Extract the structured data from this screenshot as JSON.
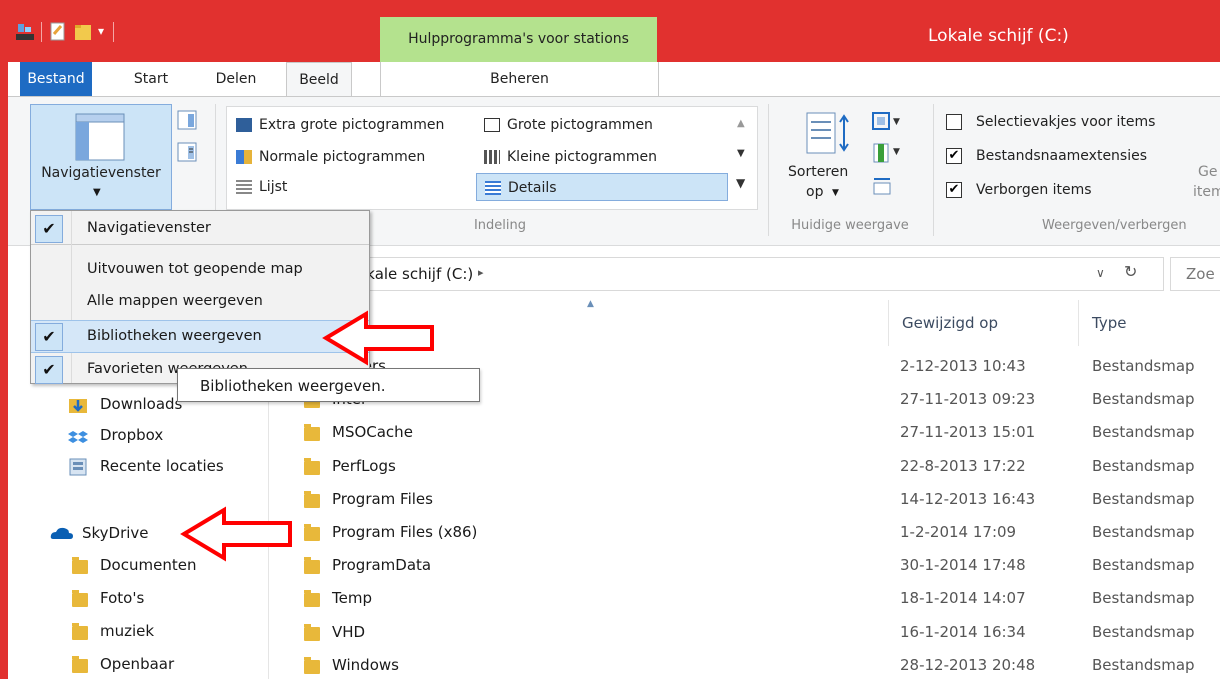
{
  "window": {
    "title": "Lokale schijf (C:)",
    "context_tab": "Hulpprogramma's voor stations",
    "context_subtab": "Beheren",
    "accent": "#e1312f",
    "context_color": "#b4e28e"
  },
  "tabs": [
    "Bestand",
    "Start",
    "Delen",
    "Beeld"
  ],
  "ribbon": {
    "panes": {
      "navpane_label": "Navigatievenster"
    },
    "layout": {
      "items": [
        "Extra grote pictogrammen",
        "Grote pictogrammen",
        "Normale pictogrammen",
        "Kleine pictogrammen",
        "Lijst",
        "Details"
      ],
      "selected": "Details",
      "group_label": "Indeling"
    },
    "current_view": {
      "sort_label_1": "Sorteren",
      "sort_label_2": "op",
      "group_label": "Huidige weergave"
    },
    "show_hide": {
      "item_checkboxes": "Selectievakjes voor items",
      "item_checkboxes_checked": false,
      "file_extensions": "Bestandsnaamextensies",
      "file_extensions_checked": true,
      "hidden_items": "Verborgen items",
      "hidden_items_checked": true,
      "hide_selected_1": "Ge",
      "hide_selected_2": "item",
      "group_label": "Weergeven/verbergen"
    }
  },
  "dropdown": {
    "items": [
      {
        "label": "Navigatievenster",
        "checked": true
      },
      {
        "label": "Uitvouwen tot geopende map",
        "checked": false
      },
      {
        "label": "Alle mappen weergeven",
        "checked": false
      },
      {
        "label": "Bibliotheken weergeven",
        "checked": true
      },
      {
        "label": "Favorieten weergeven",
        "checked": true
      }
    ],
    "tooltip": "Bibliotheken weergeven."
  },
  "address": {
    "path": "Lokale schijf (C:)",
    "search_placeholder": "Zoe"
  },
  "nav": {
    "favorites": [
      "Downloads",
      "Dropbox",
      "Recente locaties"
    ],
    "skydrive": "SkyDrive",
    "skydrive_children": [
      "Documenten",
      "Foto's",
      "muziek",
      "Openbaar"
    ]
  },
  "files": {
    "columns": {
      "modified": "Gewijzigd op",
      "type": "Type"
    },
    "rows": [
      {
        "name": "Drivers",
        "modified": "2-12-2013 10:43",
        "type": "Bestandsmap"
      },
      {
        "name": "Intel",
        "modified": "27-11-2013 09:23",
        "type": "Bestandsmap"
      },
      {
        "name": "MSOCache",
        "modified": "27-11-2013 15:01",
        "type": "Bestandsmap"
      },
      {
        "name": "PerfLogs",
        "modified": "22-8-2013 17:22",
        "type": "Bestandsmap"
      },
      {
        "name": "Program Files",
        "modified": "14-12-2013 16:43",
        "type": "Bestandsmap"
      },
      {
        "name": "Program Files (x86)",
        "modified": "1-2-2014 17:09",
        "type": "Bestandsmap"
      },
      {
        "name": "ProgramData",
        "modified": "30-1-2014 17:48",
        "type": "Bestandsmap"
      },
      {
        "name": "Temp",
        "modified": "18-1-2014 14:07",
        "type": "Bestandsmap"
      },
      {
        "name": "VHD",
        "modified": "16-1-2014 16:34",
        "type": "Bestandsmap"
      },
      {
        "name": "Windows",
        "modified": "28-12-2013 20:48",
        "type": "Bestandsmap"
      }
    ]
  },
  "annotations": {
    "arrow_color": "#ff0000"
  }
}
